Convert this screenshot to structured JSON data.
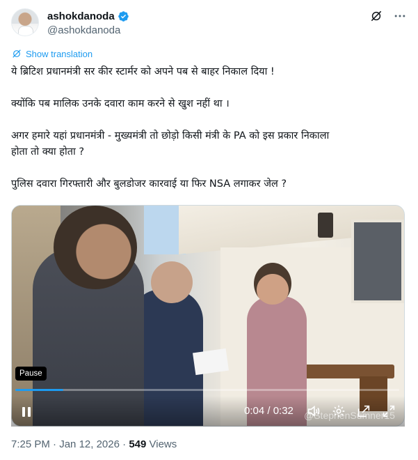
{
  "author": {
    "display_name": "ashokdanoda",
    "handle": "@ashokdanoda",
    "verified": true,
    "avatar_icon": "profile-photo"
  },
  "header_actions": {
    "grok_icon": "grok-icon",
    "more_icon": "more-icon"
  },
  "translation": {
    "label": "Show translation"
  },
  "tweet": {
    "lines": [
      "ये ब्रिटिश प्रधानमंत्री सर कीर स्टार्मर को अपने पब से बाहर निकाल दिया !",
      "क्योंकि पब मालिक उनके दवारा काम करने से खुश नहीं था ।",
      "अगर हमारे यहां प्रधानमंत्री - मुख्यमंत्री तो छोड़ो किसी मंत्री के PA को इस प्रकार निकाला",
      "होता तो क्या होता ?",
      "पुलिस दवारा गिरफ्तारी और बुलडोजर कारवाई या फिर NSA लगाकर जेल ?"
    ]
  },
  "video": {
    "pause_tooltip": "Pause",
    "current_time": "0:04",
    "duration": "0:32",
    "time_display": "0:04 / 0:32",
    "progress": 0.125,
    "watermark": "@StephenSumner15",
    "accent_color": "#1d9bf0"
  },
  "meta": {
    "time": "7:25 PM",
    "separator": "·",
    "date": "Jan 12, 2026",
    "views_count": "549",
    "views_label": "Views"
  }
}
